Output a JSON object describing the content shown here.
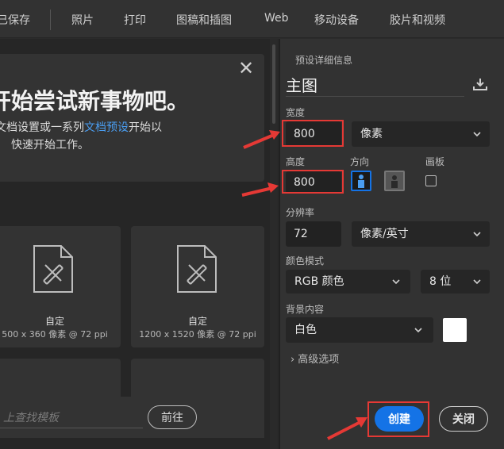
{
  "tabs": [
    "已保存",
    "照片",
    "打印",
    "图稿和插图",
    "Web",
    "移动设备",
    "胶片和视频"
  ],
  "hero": {
    "title": "开始尝试新事物吧。",
    "desc_before": "文档设置或一系列",
    "desc_link": "文档预设",
    "desc_after": "开始以",
    "desc_line2": "快速开始工作。"
  },
  "templates": [
    {
      "name": "自定",
      "size": "500 x 360 像素 @ 72 ppi"
    },
    {
      "name": "自定",
      "size": "1200 x 1520 像素 @ 72 ppi"
    }
  ],
  "search": {
    "placeholder": "上查找模板",
    "goto_label": "前往"
  },
  "panel": {
    "section_title": "预设详细信息",
    "preset_name": "主图",
    "width_label": "宽度",
    "width_value": "800",
    "width_unit": "像素",
    "height_label": "高度",
    "height_value": "800",
    "orientation_label": "方向",
    "artboard_label": "画板",
    "resolution_label": "分辨率",
    "resolution_value": "72",
    "resolution_unit": "像素/英寸",
    "color_mode_label": "颜色模式",
    "color_mode": "RGB 颜色",
    "bit_depth": "8 位",
    "background_label": "背景内容",
    "background_value": "白色",
    "background_color": "#ffffff",
    "advanced_label": "高级选项",
    "create_label": "创建",
    "close_label": "关闭"
  },
  "colors": {
    "accent": "#1473e6",
    "annotation": "#e53935"
  }
}
